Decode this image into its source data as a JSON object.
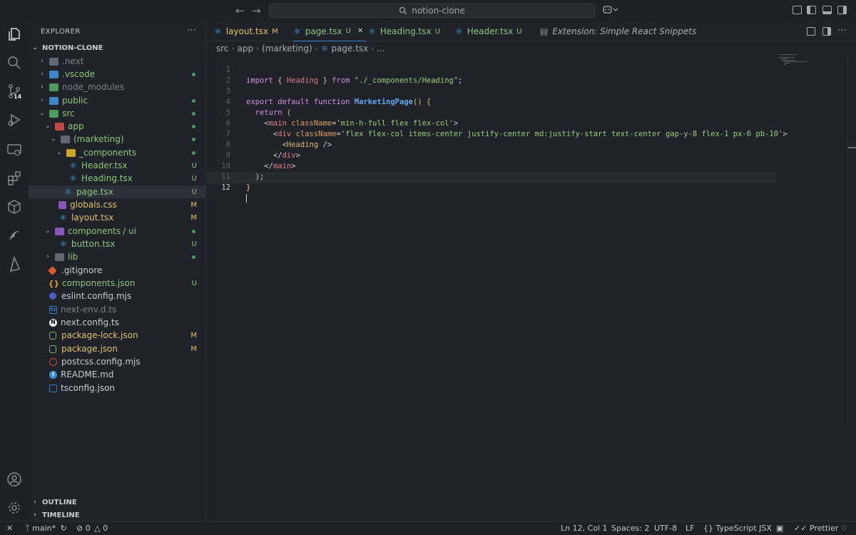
{
  "titlebar": {
    "back_icon": "arrow-left-icon",
    "forward_icon": "arrow-right-icon",
    "search_text": "notion-clone",
    "search_icon": "magnifier-icon",
    "copilot_icon": "copilot-icon"
  },
  "activity_bar": {
    "items": [
      "explorer",
      "search",
      "source-control",
      "run-debug",
      "remote-explorer",
      "extensions",
      "containers",
      "snippets",
      "prisma"
    ],
    "scm_badge": "14"
  },
  "sidebar": {
    "title": "EXPLORER",
    "more": "⋯",
    "root": "NOTION-CLONE",
    "outline": "OUTLINE",
    "timeline": "TIMELINE",
    "tree": [
      {
        "label": ".next",
        "status": "",
        "color": "#7d828b"
      },
      {
        "label": ".vscode",
        "status": "dot",
        "color": "#8ec77a"
      },
      {
        "label": "node_modules",
        "status": "",
        "color": "#7d828b"
      },
      {
        "label": "public",
        "status": "dot",
        "color": "#8ec77a"
      },
      {
        "label": "src",
        "status": "dot",
        "color": "#8ec77a"
      },
      {
        "label": "app",
        "status": "dot",
        "color": "#8ec77a"
      },
      {
        "label": "(marketing)",
        "status": "dot",
        "color": "#8ec77a"
      },
      {
        "label": "_components",
        "status": "dot",
        "color": "#8ec77a"
      },
      {
        "label": "Header.tsx",
        "status": "U",
        "color": "#8ec77a"
      },
      {
        "label": "Heading.tsx",
        "status": "U",
        "color": "#8ec77a"
      },
      {
        "label": "page.tsx",
        "status": "U",
        "color": "#8ec77a"
      },
      {
        "label": "globals.css",
        "status": "M",
        "color": "#e2c06b"
      },
      {
        "label": "layout.tsx",
        "status": "M",
        "color": "#e2c06b"
      },
      {
        "label": "components",
        "label2": "/ ui",
        "status": "dot",
        "color": "#8ec77a"
      },
      {
        "label": "button.tsx",
        "status": "U",
        "color": "#8ec77a"
      },
      {
        "label": "lib",
        "status": "dot",
        "color": "#8ec77a"
      },
      {
        "label": ".gitignore",
        "status": "",
        "color": "#c9ccd1"
      },
      {
        "label": "components.json",
        "status": "U",
        "color": "#8ec77a"
      },
      {
        "label": "eslint.config.mjs",
        "status": "",
        "color": "#c9ccd1"
      },
      {
        "label": "next-env.d.ts",
        "status": "",
        "color": "#7d828b"
      },
      {
        "label": "next.config.ts",
        "status": "",
        "color": "#c9ccd1"
      },
      {
        "label": "package-lock.json",
        "status": "M",
        "color": "#e2c06b"
      },
      {
        "label": "package.json",
        "status": "M",
        "color": "#e2c06b"
      },
      {
        "label": "postcss.config.mjs",
        "status": "",
        "color": "#c9ccd1"
      },
      {
        "label": "README.md",
        "status": "",
        "color": "#c9ccd1"
      },
      {
        "label": "tsconfig.json",
        "status": "",
        "color": "#c9ccd1"
      }
    ]
  },
  "tabs": [
    {
      "label": "layout.tsx",
      "status": "M",
      "color": "#e2c06b"
    },
    {
      "label": "page.tsx",
      "status": "U",
      "color": "#8ec77a",
      "close": "✕"
    },
    {
      "label": "Heading.tsx",
      "status": "U",
      "color": "#8ec77a"
    },
    {
      "label": "Header.tsx",
      "status": "U",
      "color": "#8ec77a"
    },
    {
      "label": "Extension: Simple React Snippets",
      "status": "",
      "color": "#a9adb5"
    }
  ],
  "breadcrumbs": [
    "src",
    "app",
    "(marketing)",
    "page.tsx",
    "..."
  ],
  "editor": {
    "line_numbers": [
      "1",
      "2",
      "3",
      "4",
      "5",
      "6",
      "7",
      "8",
      "9",
      "10",
      "11",
      "12"
    ],
    "l1": {
      "a": "import",
      "b": " { ",
      "c": "Heading",
      "d": " } ",
      "e": "from",
      "f": " ",
      "g": "\"./_components/Heading\"",
      "h": ";"
    },
    "l3": {
      "a": "export",
      "b": " ",
      "c": "default",
      "d": " ",
      "e": "function",
      "f": " ",
      "g": "MarketingPage",
      "h": "() {"
    },
    "l4": {
      "a": "  ",
      "b": "return",
      "c": " ("
    },
    "l5": {
      "a": "    <",
      "b": "main",
      "c": " ",
      "d": "className",
      "e": "=",
      "f": "'min-h-full flex flex-col'",
      "g": ">"
    },
    "l6": {
      "a": "      <",
      "b": "div",
      "c": " ",
      "d": "className",
      "e": "=",
      "f": "'flex flex-col items-center justify-center md:justify-start text-center gap-y-8 flex-1 px-6 pb-10'",
      "g": ">"
    },
    "l7": {
      "a": "        <",
      "b": "Heading",
      "c": " />"
    },
    "l8": {
      "a": "      </",
      "b": "div",
      "c": ">"
    },
    "l9": {
      "a": "    </",
      "b": "main",
      "c": ">"
    },
    "l10": {
      "a": "  );"
    },
    "l11": {
      "a": "}"
    }
  },
  "status": {
    "remote": "✕",
    "branch": "main*",
    "errors": "0",
    "warnings": "0",
    "position": "Ln 12, Col 1",
    "spaces": "Spaces: 2",
    "encoding": "UTF-8",
    "eol": "LF",
    "language_braces": "{}",
    "language": "TypeScript JSX",
    "prettier": "Prettier"
  }
}
